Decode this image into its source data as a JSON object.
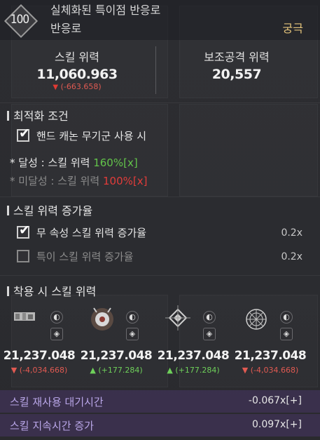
{
  "header": {
    "level": "100",
    "title": "실체화된 특이점 반응로",
    "subtitle": "반응로",
    "grade": "궁극"
  },
  "stats": {
    "skill_power_label": "스킬 위력",
    "skill_power_value": "11,060.963",
    "skill_power_delta": "(-663.658)",
    "sub_attack_label": "보조공격 위력",
    "sub_attack_value": "20,557"
  },
  "optimization": {
    "heading": "최적화 조건",
    "condition_label": "핸드 캐논 무기군 사용 시",
    "achieved_prefix": "* 달성 : 스킬 위력 ",
    "achieved_value": "160%",
    "achieved_suffix": "[x]",
    "not_achieved_prefix": "* 미달성 : 스킬 위력 ",
    "not_achieved_value": "100%",
    "not_achieved_suffix": "[x]"
  },
  "power_increase": {
    "heading": "스킬 위력 증가율",
    "rows": [
      {
        "label": "무 속성 스킬 위력 증가율",
        "value": "0.2x",
        "checked": true
      },
      {
        "label": "특이 스킬 위력 증가율",
        "value": "0.2x",
        "checked": false
      }
    ]
  },
  "equipped": {
    "heading": "착용 시 스킬 위력",
    "items": [
      {
        "value": "21,237.048",
        "delta": "(-4,034.668)",
        "direction": "down"
      },
      {
        "value": "21,237.048",
        "delta": "(+177.284)",
        "direction": "up"
      },
      {
        "value": "21,237.048",
        "delta": "(+177.284)",
        "direction": "up"
      },
      {
        "value": "21,237.048",
        "delta": "(-4,034.668)",
        "direction": "down"
      }
    ]
  },
  "bonuses": [
    {
      "label": "스킬 재사용 대기시간",
      "value": "-0.067x[+]"
    },
    {
      "label": "스킬 지속시간 증가",
      "value": "0.097x[+]"
    }
  ],
  "colors": {
    "grade": "#e2c27a",
    "positive": "#63c44a",
    "negative": "#e23c3a",
    "bonus_label": "#b9a6e8"
  }
}
